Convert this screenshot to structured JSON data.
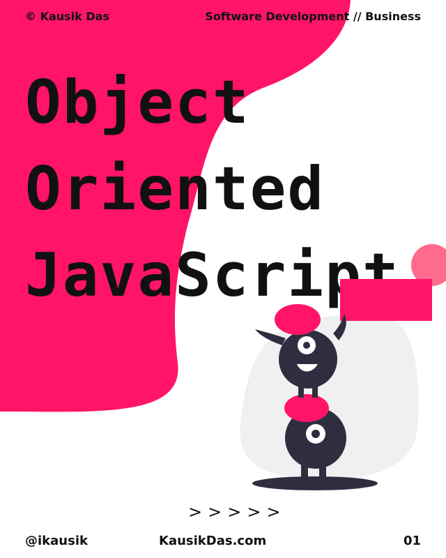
{
  "header": {
    "author": "© Kausik Das",
    "topic": "Software Development // Business"
  },
  "title": {
    "line1": "Object",
    "line2": "Oriented",
    "line3": "JavaScript"
  },
  "nav": {
    "chevrons": [
      ">",
      ">",
      ">",
      ">",
      ">"
    ]
  },
  "footer": {
    "handle": "@ikausik",
    "site": "KausikDas.com",
    "page_number": "01"
  },
  "colors": {
    "accent_pink": "#ff1468",
    "dark": "#2f2e41",
    "light_gray": "#f0f0f0"
  }
}
